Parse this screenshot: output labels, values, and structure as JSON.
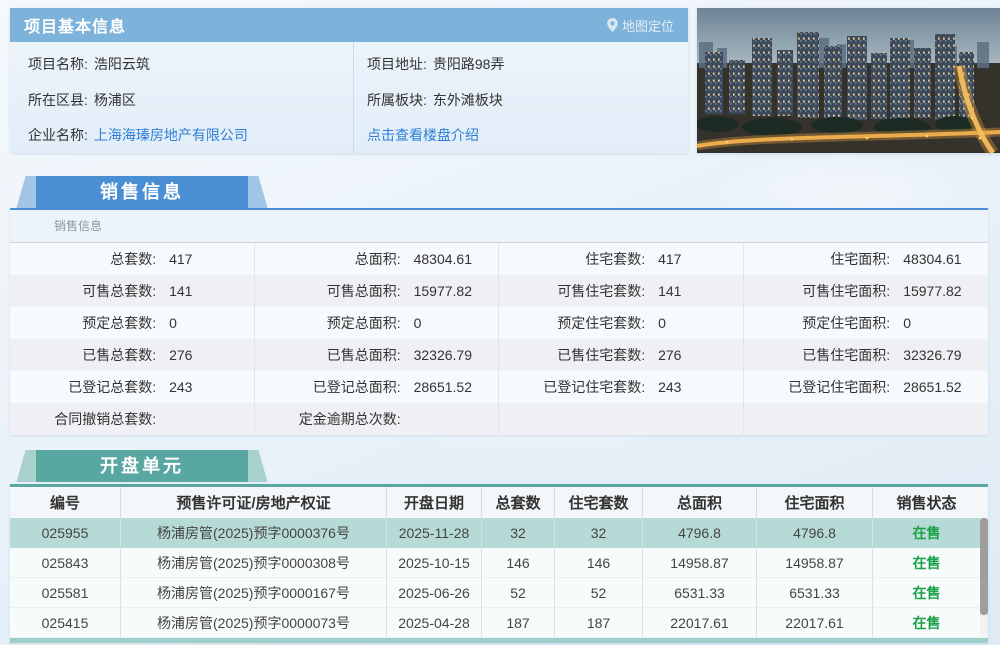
{
  "project": {
    "header_title": "项目基本信息",
    "map_button_label": "地图定位",
    "fields_left": [
      {
        "label": "项目名称:",
        "value": "浩阳云筑",
        "link": false
      },
      {
        "label": "所在区县:",
        "value": "杨浦区",
        "link": false
      },
      {
        "label": "企业名称:",
        "value": "上海海瑧房地产有限公司",
        "link": true
      }
    ],
    "fields_right": [
      {
        "label": "项目地址:",
        "value": "贵阳路98弄",
        "link": false
      },
      {
        "label": "所属板块:",
        "value": "东外滩板块",
        "link": false
      },
      {
        "label": "",
        "value": "点击查看楼盘介绍",
        "link": true
      }
    ]
  },
  "sales": {
    "tab_label": "销售信息",
    "subtitle": "销售信息",
    "rows": [
      [
        {
          "label": "总套数:",
          "value": "417"
        },
        {
          "label": "总面积:",
          "value": "48304.61"
        },
        {
          "label": "住宅套数:",
          "value": "417"
        },
        {
          "label": "住宅面积:",
          "value": "48304.61"
        }
      ],
      [
        {
          "label": "可售总套数:",
          "value": "141"
        },
        {
          "label": "可售总面积:",
          "value": "15977.82"
        },
        {
          "label": "可售住宅套数:",
          "value": "141"
        },
        {
          "label": "可售住宅面积:",
          "value": "15977.82"
        }
      ],
      [
        {
          "label": "预定总套数:",
          "value": "0"
        },
        {
          "label": "预定总面积:",
          "value": "0"
        },
        {
          "label": "预定住宅套数:",
          "value": "0"
        },
        {
          "label": "预定住宅面积:",
          "value": "0"
        }
      ],
      [
        {
          "label": "已售总套数:",
          "value": "276"
        },
        {
          "label": "已售总面积:",
          "value": "32326.79"
        },
        {
          "label": "已售住宅套数:",
          "value": "276"
        },
        {
          "label": "已售住宅面积:",
          "value": "32326.79"
        }
      ],
      [
        {
          "label": "已登记总套数:",
          "value": "243"
        },
        {
          "label": "已登记总面积:",
          "value": "28651.52"
        },
        {
          "label": "已登记住宅套数:",
          "value": "243"
        },
        {
          "label": "已登记住宅面积:",
          "value": "28651.52"
        }
      ],
      [
        {
          "label": "合同撤销总套数:",
          "value": ""
        },
        {
          "label": "定金逾期总次数:",
          "value": ""
        },
        {
          "label": "",
          "value": ""
        },
        {
          "label": "",
          "value": ""
        }
      ]
    ]
  },
  "units": {
    "tab_label": "开盘单元",
    "columns": [
      "编号",
      "预售许可证/房地产权证",
      "开盘日期",
      "总套数",
      "住宅套数",
      "总面积",
      "住宅面积",
      "销售状态"
    ],
    "rows": [
      {
        "cells": [
          "025955",
          "杨浦房管(2025)预字0000376号",
          "2025-11-28",
          "32",
          "32",
          "4796.8",
          "4796.8",
          "在售"
        ],
        "highlight": true
      },
      {
        "cells": [
          "025843",
          "杨浦房管(2025)预字0000308号",
          "2025-10-15",
          "146",
          "146",
          "14958.87",
          "14958.87",
          "在售"
        ],
        "highlight": false
      },
      {
        "cells": [
          "025581",
          "杨浦房管(2025)预字0000167号",
          "2025-06-26",
          "52",
          "52",
          "6531.33",
          "6531.33",
          "在售"
        ],
        "highlight": false
      },
      {
        "cells": [
          "025415",
          "杨浦房管(2025)预字0000073号",
          "2025-04-28",
          "187",
          "187",
          "22017.61",
          "22017.61",
          "在售"
        ],
        "highlight": false
      }
    ]
  },
  "icons": {
    "map_pin": "location-pin-icon"
  },
  "colors": {
    "header_blue": "#7db3da",
    "accent_blue": "#4a8fd4",
    "accent_teal": "#58a7a0",
    "link_blue": "#2e7fd6",
    "status_green": "#1aa148",
    "row_highlight": "#b6dad5"
  }
}
